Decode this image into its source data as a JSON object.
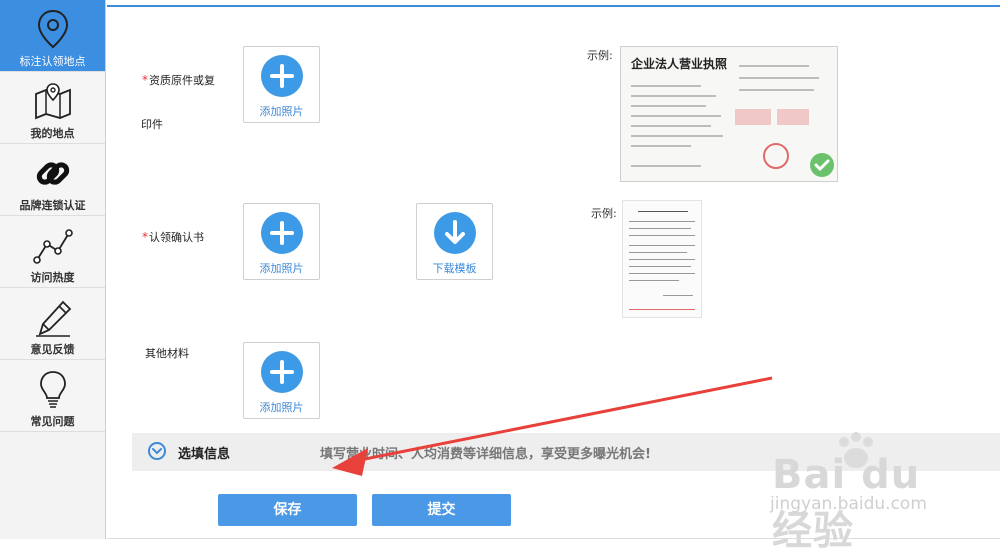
{
  "sidebar": {
    "items": [
      {
        "label": "标注认领地点",
        "icon": "map-pin-icon",
        "active": true
      },
      {
        "label": "我的地点",
        "icon": "folded-map-icon",
        "active": false
      },
      {
        "label": "品牌连锁认证",
        "icon": "chain-link-icon",
        "active": false
      },
      {
        "label": "访问热度",
        "icon": "line-trend-icon",
        "active": false
      },
      {
        "label": "意见反馈",
        "icon": "pencil-icon",
        "active": false
      },
      {
        "label": "常见问题",
        "icon": "lightbulb-icon",
        "active": false
      }
    ]
  },
  "form": {
    "qualification": {
      "label_line1": "资质原件或复",
      "label_line2": "印件",
      "upload_label": "添加照片",
      "example_label": "示例:"
    },
    "claim_letter": {
      "label": "认领确认书",
      "upload_label": "添加照片",
      "download_label": "下载模板",
      "example_label": "示例:"
    },
    "other": {
      "label": "其他材料",
      "upload_label": "添加照片"
    }
  },
  "license_sample": {
    "title": "企业法人营业执照"
  },
  "optional": {
    "title": "选填信息",
    "hint": "填写营业时间、人均消费等详细信息，享受更多曝光机会!"
  },
  "buttons": {
    "save": "保存",
    "submit": "提交"
  },
  "watermark": {
    "brand": "Bai du 经验",
    "url": "jingyan.baidu.com"
  },
  "colors": {
    "accent": "#3b8ee0",
    "required": "#e33333",
    "annotation_arrow": "#e8403a"
  }
}
